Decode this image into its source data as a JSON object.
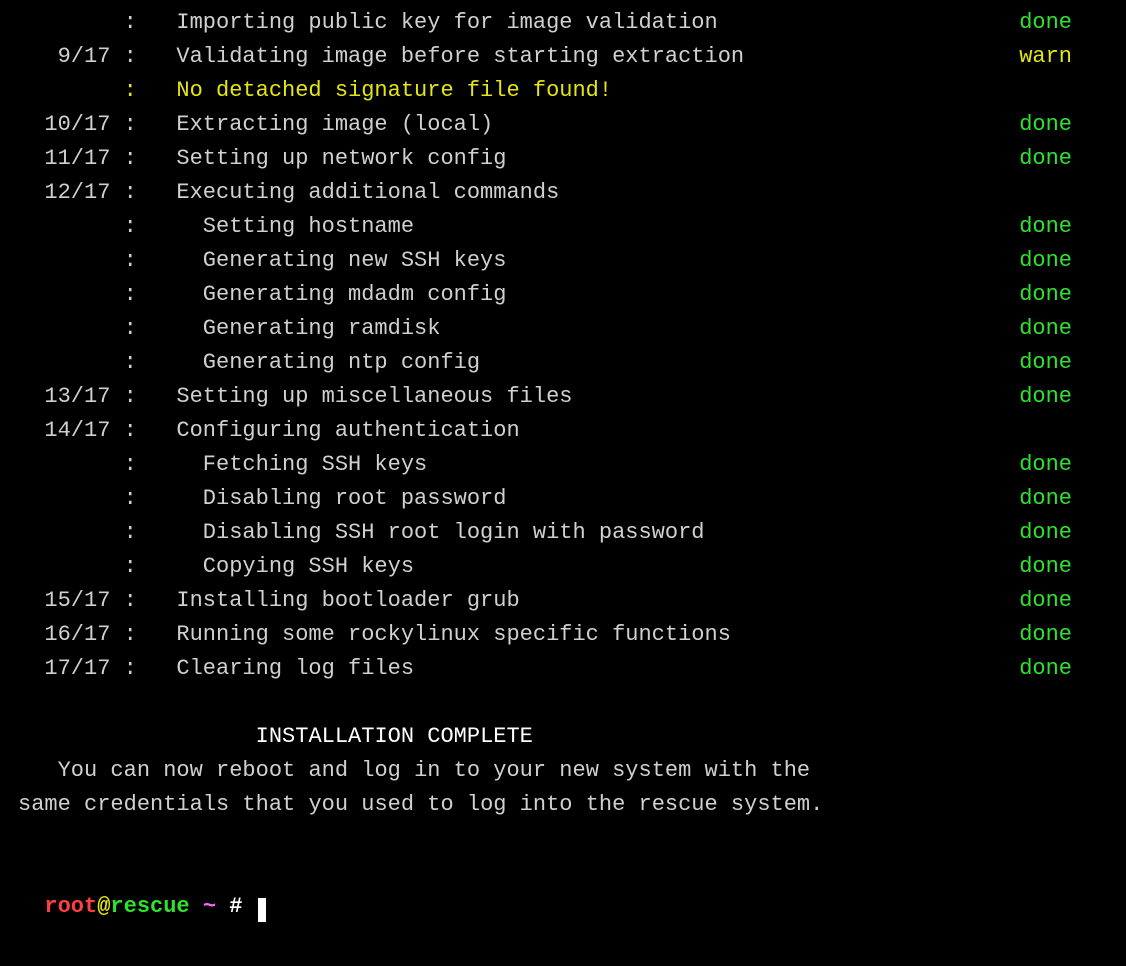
{
  "lines": [
    {
      "step": "",
      "colon": ":",
      "msg": "Importing public key for image validation",
      "statusText": "done",
      "statusClass": "done",
      "indent": 0,
      "msgClass": "grey"
    },
    {
      "step": "9/17",
      "colon": ":",
      "msg": "Validating image before starting extraction",
      "statusText": "warn",
      "statusClass": "warn",
      "indent": 0,
      "msgClass": "grey"
    },
    {
      "step": "",
      "colon": ":",
      "msg": "No detached signature file found!",
      "statusText": "",
      "statusClass": "",
      "indent": 0,
      "msgClass": "yellow",
      "colonClass": "yellow"
    },
    {
      "step": "10/17",
      "colon": ":",
      "msg": "Extracting image (local)",
      "statusText": "done",
      "statusClass": "done",
      "indent": 0,
      "msgClass": "grey"
    },
    {
      "step": "11/17",
      "colon": ":",
      "msg": "Setting up network config",
      "statusText": "done",
      "statusClass": "done",
      "indent": 0,
      "msgClass": "grey"
    },
    {
      "step": "12/17",
      "colon": ":",
      "msg": "Executing additional commands",
      "statusText": "",
      "statusClass": "",
      "indent": 0,
      "msgClass": "grey"
    },
    {
      "step": "",
      "colon": ":",
      "msg": "Setting hostname",
      "statusText": "done",
      "statusClass": "done",
      "indent": 2,
      "msgClass": "grey"
    },
    {
      "step": "",
      "colon": ":",
      "msg": "Generating new SSH keys",
      "statusText": "done",
      "statusClass": "done",
      "indent": 2,
      "msgClass": "grey"
    },
    {
      "step": "",
      "colon": ":",
      "msg": "Generating mdadm config",
      "statusText": "done",
      "statusClass": "done",
      "indent": 2,
      "msgClass": "grey"
    },
    {
      "step": "",
      "colon": ":",
      "msg": "Generating ramdisk",
      "statusText": "done",
      "statusClass": "done",
      "indent": 2,
      "msgClass": "grey"
    },
    {
      "step": "",
      "colon": ":",
      "msg": "Generating ntp config",
      "statusText": "done",
      "statusClass": "done",
      "indent": 2,
      "msgClass": "grey"
    },
    {
      "step": "13/17",
      "colon": ":",
      "msg": "Setting up miscellaneous files",
      "statusText": "done",
      "statusClass": "done",
      "indent": 0,
      "msgClass": "grey"
    },
    {
      "step": "14/17",
      "colon": ":",
      "msg": "Configuring authentication",
      "statusText": "",
      "statusClass": "",
      "indent": 0,
      "msgClass": "grey"
    },
    {
      "step": "",
      "colon": ":",
      "msg": "Fetching SSH keys",
      "statusText": "done",
      "statusClass": "done",
      "indent": 2,
      "msgClass": "grey"
    },
    {
      "step": "",
      "colon": ":",
      "msg": "Disabling root password",
      "statusText": "done",
      "statusClass": "done",
      "indent": 2,
      "msgClass": "grey"
    },
    {
      "step": "",
      "colon": ":",
      "msg": "Disabling SSH root login with password",
      "statusText": "done",
      "statusClass": "done",
      "indent": 2,
      "msgClass": "grey"
    },
    {
      "step": "",
      "colon": ":",
      "msg": "Copying SSH keys",
      "statusText": "done",
      "statusClass": "done",
      "indent": 2,
      "msgClass": "grey"
    },
    {
      "step": "15/17",
      "colon": ":",
      "msg": "Installing bootloader grub",
      "statusText": "done",
      "statusClass": "done",
      "indent": 0,
      "msgClass": "grey"
    },
    {
      "step": "16/17",
      "colon": ":",
      "msg": "Running some rockylinux specific functions",
      "statusText": "done",
      "statusClass": "done",
      "indent": 0,
      "msgClass": "grey"
    },
    {
      "step": "17/17",
      "colon": ":",
      "msg": "Clearing log files",
      "statusText": "done",
      "statusClass": "done",
      "indent": 0,
      "msgClass": "grey"
    }
  ],
  "completion": {
    "title": "                  INSTALLATION COMPLETE",
    "line1": "   You can now reboot and log in to your new system with the",
    "line2": "same credentials that you used to log into the rescue system."
  },
  "prompt": {
    "user": "root",
    "at": "@",
    "host": "rescue",
    "sep1": " ",
    "path": "~",
    "sep2": " ",
    "hash": "#",
    "trail": " "
  }
}
